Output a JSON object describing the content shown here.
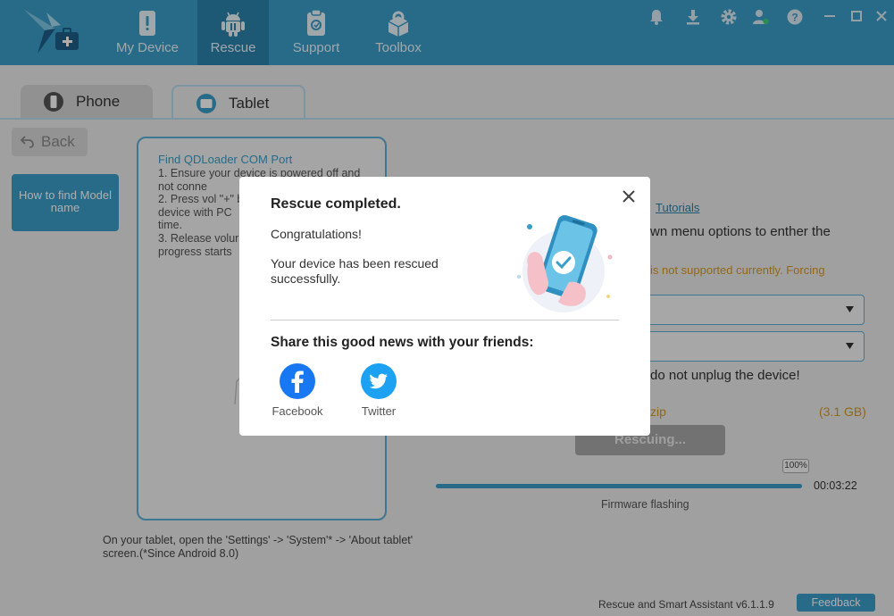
{
  "nav": {
    "items": [
      {
        "label": "My Device",
        "icon": "phone-alert-icon"
      },
      {
        "label": "Rescue",
        "icon": "android-icon",
        "active": true
      },
      {
        "label": "Support",
        "icon": "clipboard-icon"
      },
      {
        "label": "Toolbox",
        "icon": "toolbox-icon"
      }
    ]
  },
  "tabs": {
    "phone": "Phone",
    "tablet": "Tablet"
  },
  "back_label": "Back",
  "howto_label": "How to find Model name",
  "guide": {
    "title": "Find QDLoader COM Port",
    "step1": "1. Ensure your device is powered off and not conne",
    "step2": "2. Press vol \"+\" b",
    "step2b": "device with PC",
    "step2c": "time.",
    "step3": "3. Release volur",
    "step3b": "progress starts"
  },
  "guide_note": "On your tablet, open the 'Settings' -> 'System'* -> 'About tablet' screen.(*Since Android 8.0)",
  "rescue": {
    "tutorials_link": "Tutorials",
    "instruction": "wn menu options to enther the",
    "warning": "is not supported currently. Forcing",
    "unplug_note": "do not unplug the device!",
    "zip_label": "zip",
    "zip_size": "(3.1 GB)",
    "rescuing_label": "Rescuing...",
    "progress_percent": "100%",
    "progress_value": 1.0,
    "elapsed": "00:03:22",
    "phase": "Firmware flashing"
  },
  "footer": {
    "version": "Rescue and Smart Assistant v6.1.1.9",
    "feedback": "Feedback"
  },
  "modal": {
    "title": "Rescue completed.",
    "congrats": "Congratulations!",
    "message": "Your device has been rescued successfully.",
    "share_title": "Share this good news with your friends:",
    "facebook": "Facebook",
    "twitter": "Twitter"
  },
  "colors": {
    "brand_blue": "#3a9ecb",
    "active_nav": "#2c82ad",
    "warning_orange": "#d89a22",
    "facebook": "#1877f2",
    "twitter": "#1da1f2"
  }
}
